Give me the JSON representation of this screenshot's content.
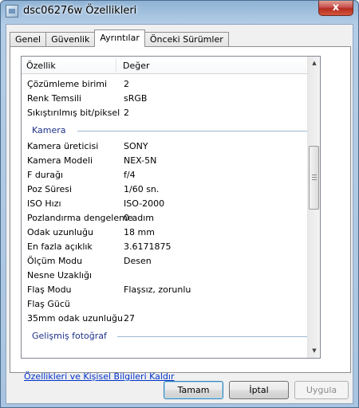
{
  "window": {
    "title": "dsc06276w Özellikleri",
    "close_label": "x"
  },
  "tabs": [
    {
      "label": "Genel"
    },
    {
      "label": "Güvenlik"
    },
    {
      "label": "Ayrıntılar"
    },
    {
      "label": "Önceki Sürümler"
    }
  ],
  "details": {
    "header": {
      "property": "Özellik",
      "value": "Değer"
    },
    "image_rows": [
      {
        "k": "Çözümleme birimi",
        "v": "2"
      },
      {
        "k": "Renk Temsili",
        "v": "sRGB"
      },
      {
        "k": "Sıkıştırılmış bit/piksel",
        "v": "2"
      }
    ],
    "camera_group": "Kamera",
    "camera_rows": [
      {
        "k": "Kamera üreticisi",
        "v": "SONY"
      },
      {
        "k": "Kamera Modeli",
        "v": "NEX-5N"
      },
      {
        "k": "F durağı",
        "v": "f/4"
      },
      {
        "k": "Poz Süresi",
        "v": "1/60 sn."
      },
      {
        "k": "ISO Hızı",
        "v": "ISO-2000"
      },
      {
        "k": "Pozlandırma dengeleme",
        "v": "0 adım"
      },
      {
        "k": "Odak uzunluğu",
        "v": "18 mm"
      },
      {
        "k": "En fazla açıklık",
        "v": "3.6171875"
      },
      {
        "k": "Ölçüm Modu",
        "v": "Desen"
      },
      {
        "k": "Nesne Uzaklığı",
        "v": ""
      },
      {
        "k": "Flaş Modu",
        "v": "Flaşsız, zorunlu"
      },
      {
        "k": "Flaş Gücü",
        "v": ""
      },
      {
        "k": "35mm odak uzunluğu",
        "v": "27"
      }
    ],
    "advanced_group": "Gelişmiş fotoğraf"
  },
  "remove_link": "Özellikleri ve Kişisel Bilgileri Kaldır",
  "buttons": {
    "ok": "Tamam",
    "cancel": "İptal",
    "apply": "Uygula"
  }
}
